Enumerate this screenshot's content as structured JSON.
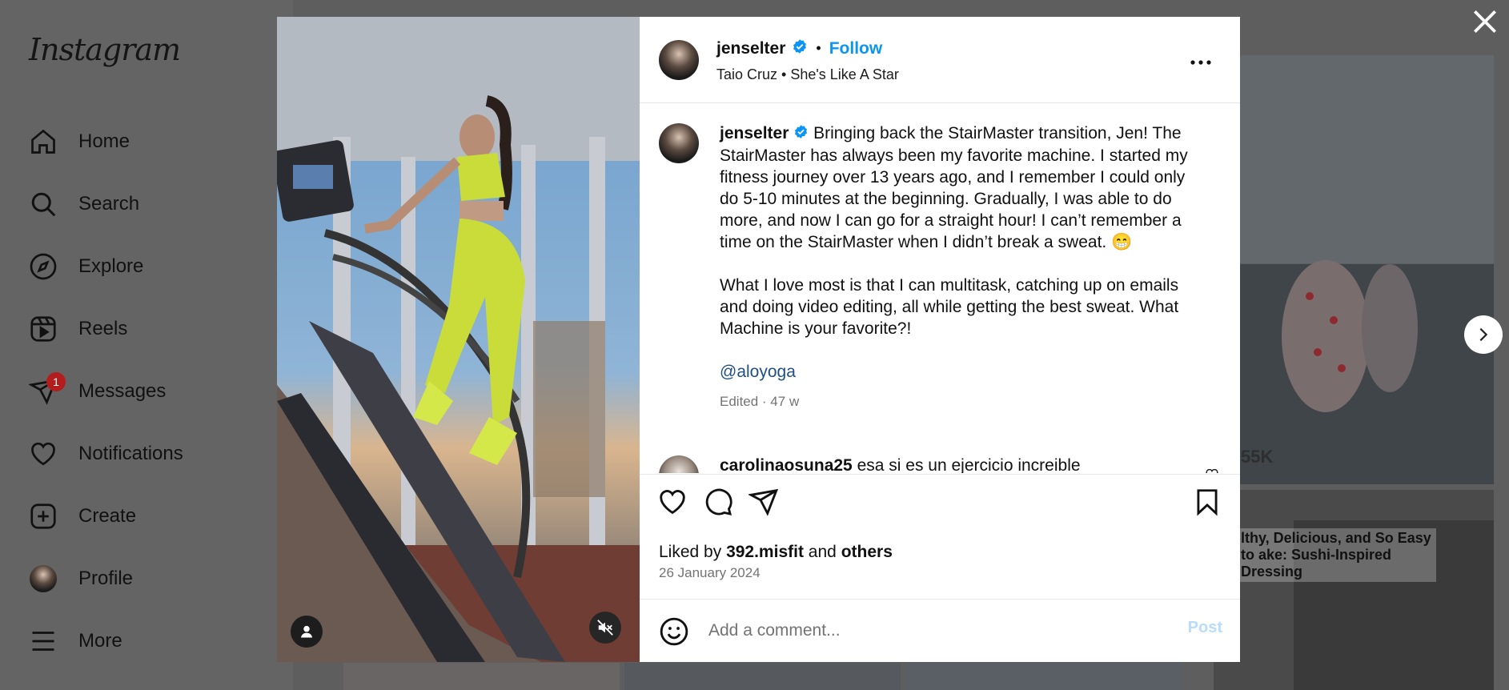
{
  "brand": "Instagram",
  "sidebar": {
    "items": [
      {
        "label": "Home",
        "icon": "home-icon"
      },
      {
        "label": "Search",
        "icon": "search-icon"
      },
      {
        "label": "Explore",
        "icon": "compass-icon"
      },
      {
        "label": "Reels",
        "icon": "reels-icon"
      },
      {
        "label": "Messages",
        "icon": "messages-icon",
        "badge": "1"
      },
      {
        "label": "Notifications",
        "icon": "heart-icon"
      },
      {
        "label": "Create",
        "icon": "plus-square-icon"
      },
      {
        "label": "Profile",
        "icon": "avatar"
      },
      {
        "label": "More",
        "icon": "menu-icon"
      }
    ]
  },
  "background": {
    "tile_count": "55K",
    "tile_caption": "lthy, Delicious, and So Easy to ake: Sushi-Inspired Dressing"
  },
  "post": {
    "author": "jenselter",
    "follow_label": "Follow",
    "separator": "•",
    "audio": "Taio Cruz • She's Like A Star",
    "caption_para1": "Bringing back the StairMaster transition, Jen! The StairMaster has always been my favorite machine. I started my fitness journey over 13 years ago, and I remember I could only do 5-10 minutes at the beginning. Gradually, I was able to do more, and now I can go for a straight hour! I can’t remember a time on the StairMaster when I didn’t break a sweat. 😁",
    "caption_para2": "What I love most is that I can multitask, catching up on emails and doing video editing, all while getting the best sweat. What Machine is your favorite?!",
    "mention": "@aloyoga",
    "edited_meta": "Edited · 47 w",
    "comment": {
      "user": "carolinaosuna25",
      "text": "esa si es un ejercicio increible felicidades, dedicación 💪🏼"
    },
    "liked_by_prefix": "Liked by",
    "liked_by_user": "392.misfit",
    "liked_by_and": "and",
    "liked_by_others": "others",
    "date": "26 January 2024",
    "comment_placeholder": "Add a comment...",
    "post_label": "Post"
  },
  "colors": {
    "accent": "#0a95f6",
    "mention": "#1f4f86",
    "badge": "#b41d1d",
    "legging": "#c9dc3a"
  }
}
